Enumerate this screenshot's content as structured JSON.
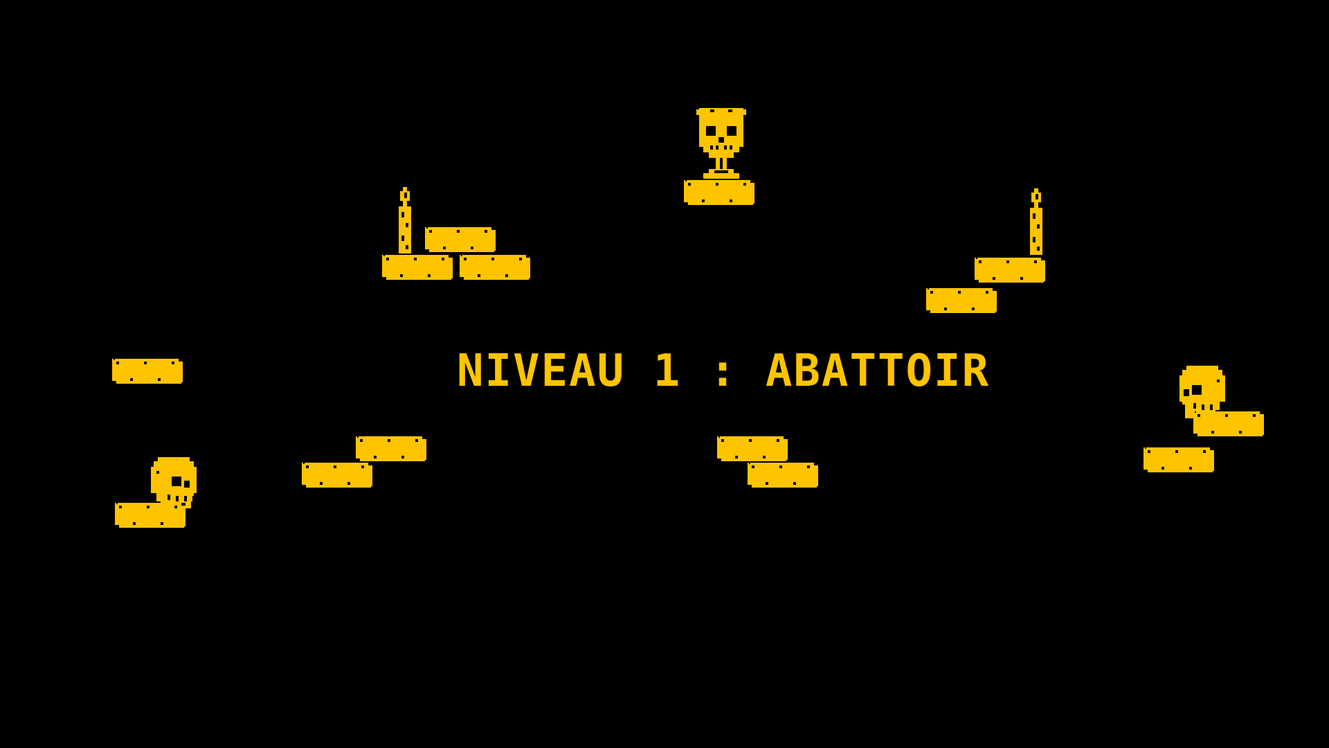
{
  "level": {
    "title": "NIVEAU 1 : ABATTOIR"
  },
  "colors": {
    "background": "#000000",
    "accent": "#ffc400"
  },
  "sprites": {
    "goal_icon": "skull-chalice-icon",
    "candle_icon": "candle-icon",
    "skull_icon": "skull-icon",
    "platform": "brick-platform"
  }
}
